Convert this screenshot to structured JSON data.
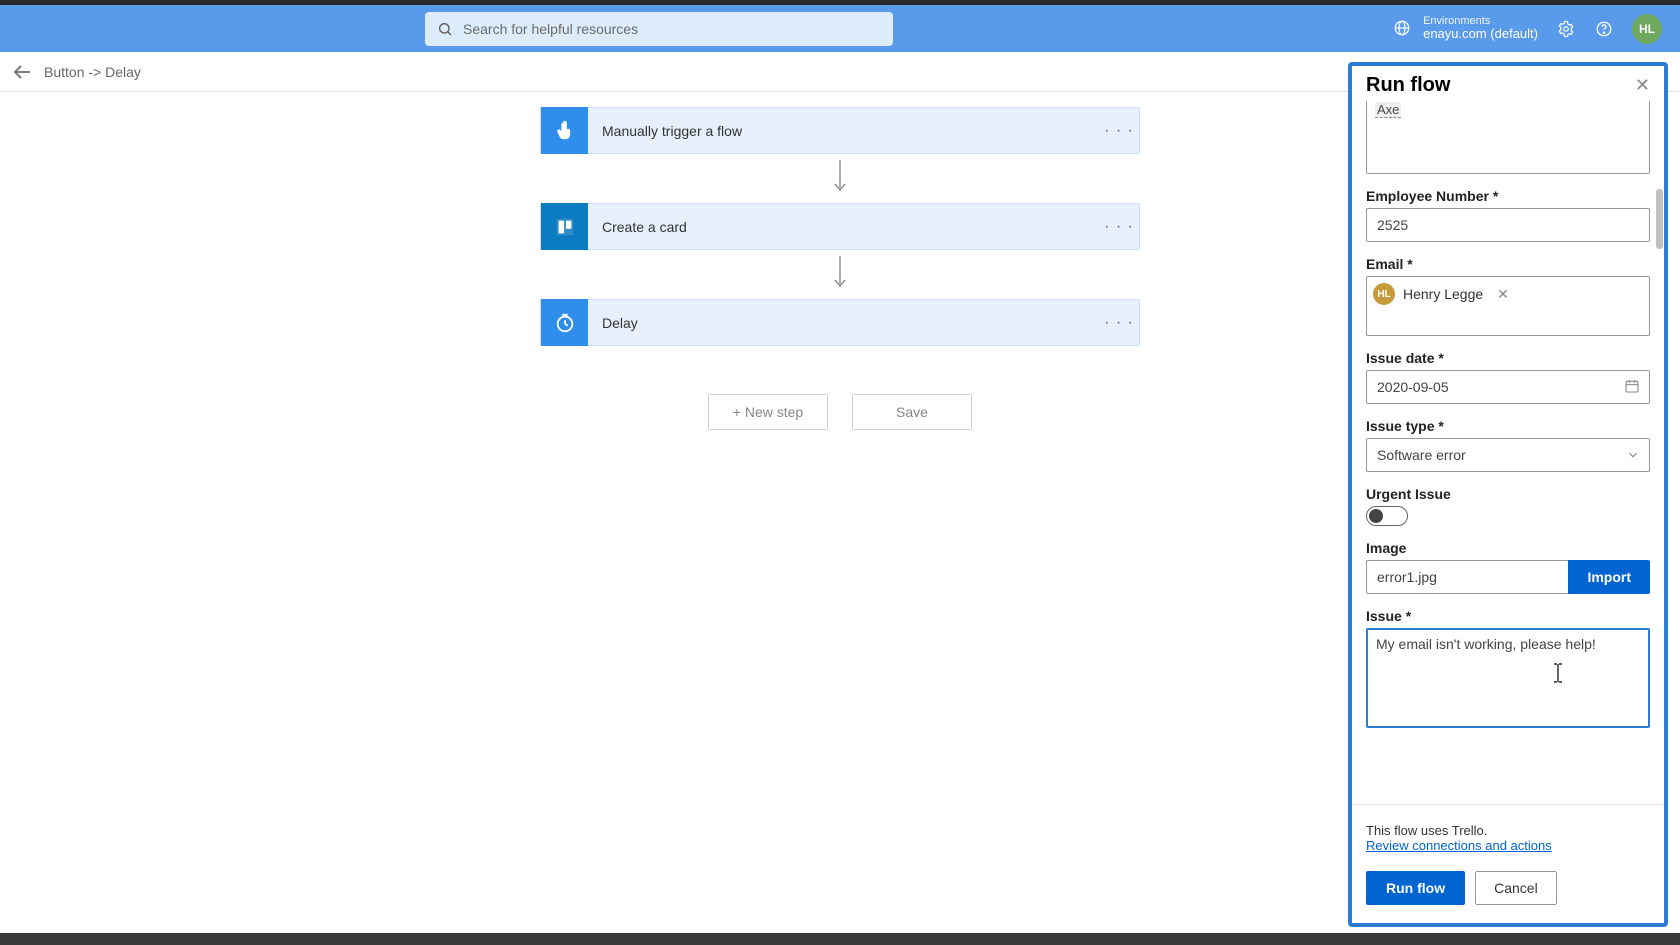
{
  "header": {
    "search_placeholder": "Search for helpful resources",
    "env_label": "Environments",
    "env_name": "enayu.com (default)",
    "avatar_initials": "HL"
  },
  "breadcrumb": "Button -> Delay",
  "flow": {
    "steps": [
      {
        "label": "Manually trigger a flow",
        "icon": "touch"
      },
      {
        "label": "Create a card",
        "icon": "trello"
      },
      {
        "label": "Delay",
        "icon": "clock"
      }
    ],
    "new_step": "+ New step",
    "save": "Save"
  },
  "panel": {
    "title": "Run flow",
    "first_value": "Axe",
    "fields": {
      "emp_num_label": "Employee Number *",
      "emp_num_value": "2525",
      "email_label": "Email *",
      "email_person": "Henry Legge",
      "email_initials": "HL",
      "date_label": "Issue date *",
      "date_value": "2020-09-05",
      "type_label": "Issue type *",
      "type_value": "Software error",
      "urgent_label": "Urgent Issue",
      "image_label": "Image",
      "image_value": "error1.jpg",
      "import": "Import",
      "issue_label": "Issue *",
      "issue_value": "My email isn't working, please help!"
    },
    "info_text": "This flow uses Trello.",
    "review_link": "Review connections and actions",
    "run": "Run flow",
    "cancel": "Cancel"
  }
}
